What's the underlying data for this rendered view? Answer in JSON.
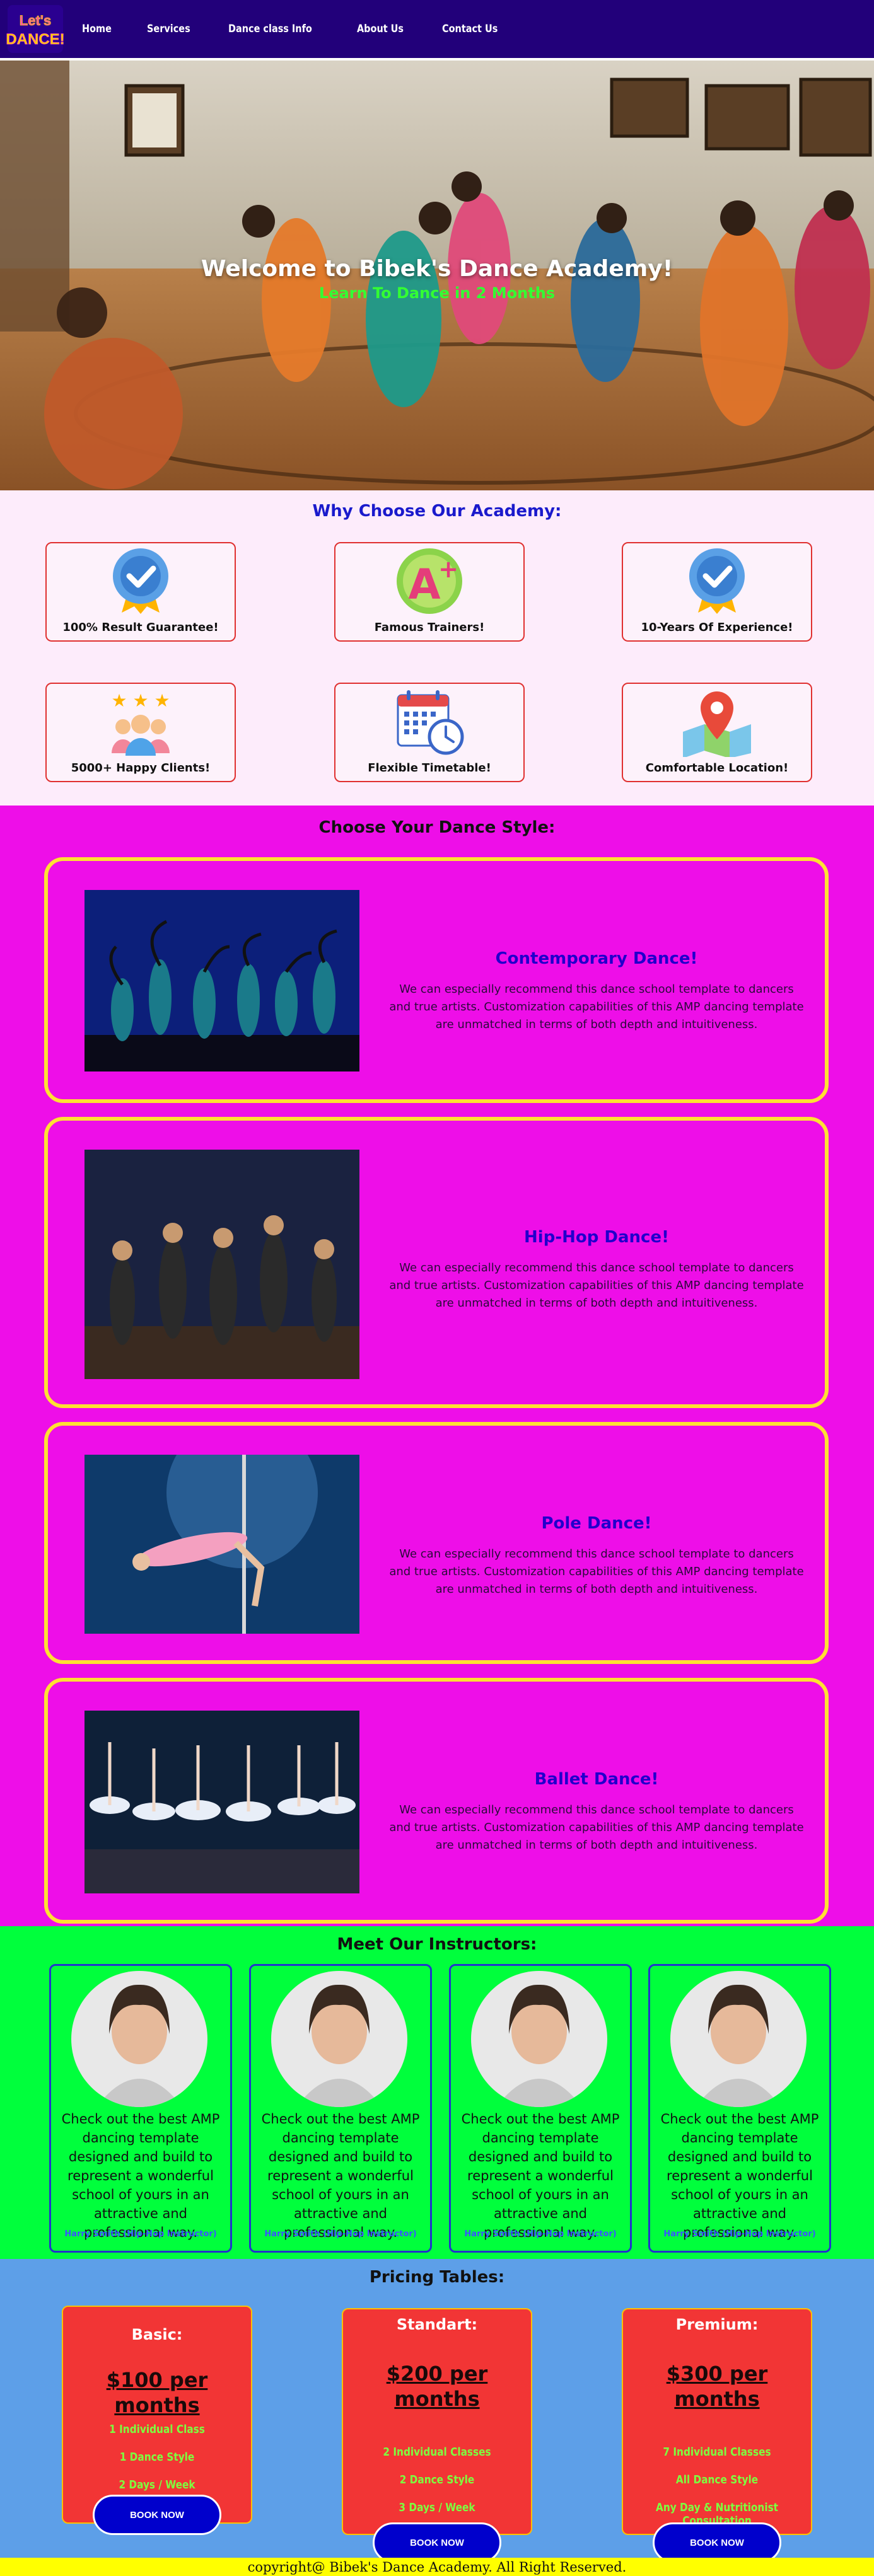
{
  "nav": {
    "logo_text_top": "Let's",
    "logo_text_bottom": "DANCE!",
    "items": [
      "Home",
      "Services",
      "Dance class Info",
      "About Us",
      "Contact Us"
    ]
  },
  "hero": {
    "title": "Welcome to Bibek's Dance Academy!",
    "subtitle": "Learn To Dance in 2 Months"
  },
  "why": {
    "title": "Why Choose Our Academy:",
    "cards": [
      {
        "label": "100% Result Guarantee!",
        "icon": "badge-check-icon"
      },
      {
        "label": "Famous Trainers!",
        "icon": "a-plus-grade-icon"
      },
      {
        "label": "10-Years Of Experience!",
        "icon": "badge-check-icon"
      },
      {
        "label": "5000+ Happy Clients!",
        "icon": "happy-clients-icon"
      },
      {
        "label": "Flexible Timetable!",
        "icon": "calendar-clock-icon"
      },
      {
        "label": "Comfortable Location!",
        "icon": "map-pin-icon"
      }
    ]
  },
  "styles": {
    "title": "Choose Your Dance Style:",
    "items": [
      {
        "name": "Contemporary Dance!",
        "desc": "We can especially recommend this dance school template to dancers and true artists. Customization capabilities of this AMP dancing template are unmatched in terms of both depth and intuitiveness."
      },
      {
        "name": "Hip-Hop Dance!",
        "desc": "We can especially recommend this dance school template to dancers and true artists. Customization capabilities of this AMP dancing template are unmatched in terms of both depth and intuitiveness."
      },
      {
        "name": "Pole Dance!",
        "desc": "We can especially recommend this dance school template to dancers and true artists. Customization capabilities of this AMP dancing template are unmatched in terms of both depth and intuitiveness."
      },
      {
        "name": "Ballet Dance!",
        "desc": "We can especially recommend this dance school template to dancers and true artists. Customization capabilities of this AMP dancing template are unmatched in terms of both depth and intuitiveness."
      }
    ]
  },
  "instructors": {
    "title": "Meet Our Instructors:",
    "items": [
      {
        "text": "Check out the best AMP dancing template designed and build to represent a wonderful school of yours in an attractive and professional way.",
        "name": "Harry Smith (Hip-Hop Instructor)"
      },
      {
        "text": "Check out the best AMP dancing template designed and build to represent a wonderful school of yours in an attractive and professional way.",
        "name": "Harry Smith (Hip-Hop Instructor)"
      },
      {
        "text": "Check out the best AMP dancing template designed and build to represent a wonderful school of yours in an attractive and professional way.",
        "name": "Harry Smith (Hip-Hop Instructor)"
      },
      {
        "text": "Check out the best AMP dancing template designed and build to represent a wonderful school of yours in an attractive and professional way.",
        "name": "Harry Smith (Hip-Hop Instructor)"
      }
    ]
  },
  "pricing": {
    "title": "Pricing Tables:",
    "plans": [
      {
        "title": "Basic:",
        "price": "$100 per months",
        "features": [
          "1 Individual Class",
          "1 Dance Style",
          "2 Days / Week"
        ],
        "button": "BOOK NOW"
      },
      {
        "title": "Standart:",
        "price": "$200 per months",
        "features": [
          "2 Individual Classes",
          "2 Dance Style",
          "3 Days / Week"
        ],
        "button": "BOOK NOW"
      },
      {
        "title": "Premium:",
        "price": "$300 per months",
        "features": [
          "7 Individual Classes",
          "All Dance Style",
          "Any Day & Nutritionist Consultation"
        ],
        "button": "BOOK NOW"
      }
    ]
  },
  "footer": {
    "copyright": "copyright@ Bibek's Dance Academy. All Right Reserved."
  },
  "colors": {
    "navbar": "#22007a",
    "why_bg": "#fdecfb",
    "styles_bg": "#ee0ee8",
    "instructors_bg": "#00ff3c",
    "pricing_bg": "#5d9fe8",
    "footer_bg": "#ffff00"
  }
}
